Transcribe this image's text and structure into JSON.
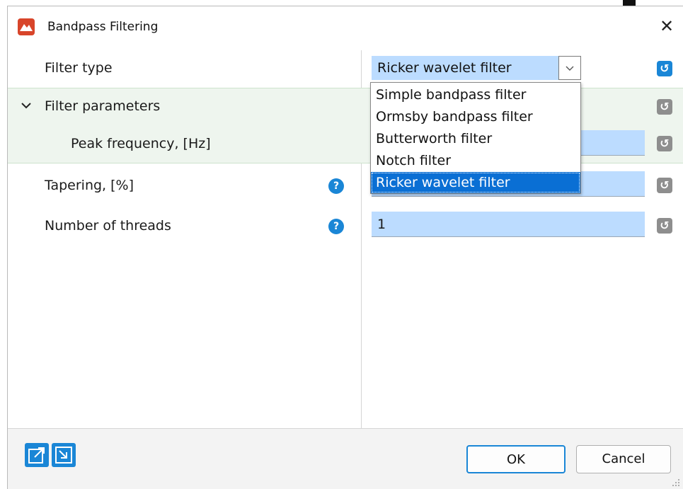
{
  "window": {
    "title": "Bandpass Filtering",
    "close_glyph": "✕"
  },
  "rows": {
    "filter_type": {
      "label": "Filter type",
      "value": "Ricker wavelet filter"
    },
    "filter_parameters": {
      "label": "Filter parameters"
    },
    "peak_frequency": {
      "label": "Peak frequency, [Hz]",
      "value": ""
    },
    "tapering": {
      "label": "Tapering, [%]",
      "value": ""
    },
    "threads": {
      "label": "Number of threads",
      "value": "1"
    }
  },
  "dropdown": {
    "options": [
      "Simple bandpass filter",
      "Ormsby bandpass filter",
      "Butterworth filter",
      "Notch filter",
      "Ricker wavelet filter"
    ],
    "selected": "Ricker wavelet filter"
  },
  "glyphs": {
    "help": "?",
    "reset": "↺"
  },
  "footer": {
    "ok_label": "OK",
    "cancel_label": "Cancel"
  },
  "colors": {
    "accent": "#1a86d6",
    "field": "#bcdcff",
    "group_bg": "#eef5ee",
    "selection": "#0a6fd4"
  },
  "icons": {
    "app": "app-logo-icon",
    "help": "help-icon",
    "reset": "reset-icon",
    "export": "export-icon",
    "import": "import-icon"
  }
}
